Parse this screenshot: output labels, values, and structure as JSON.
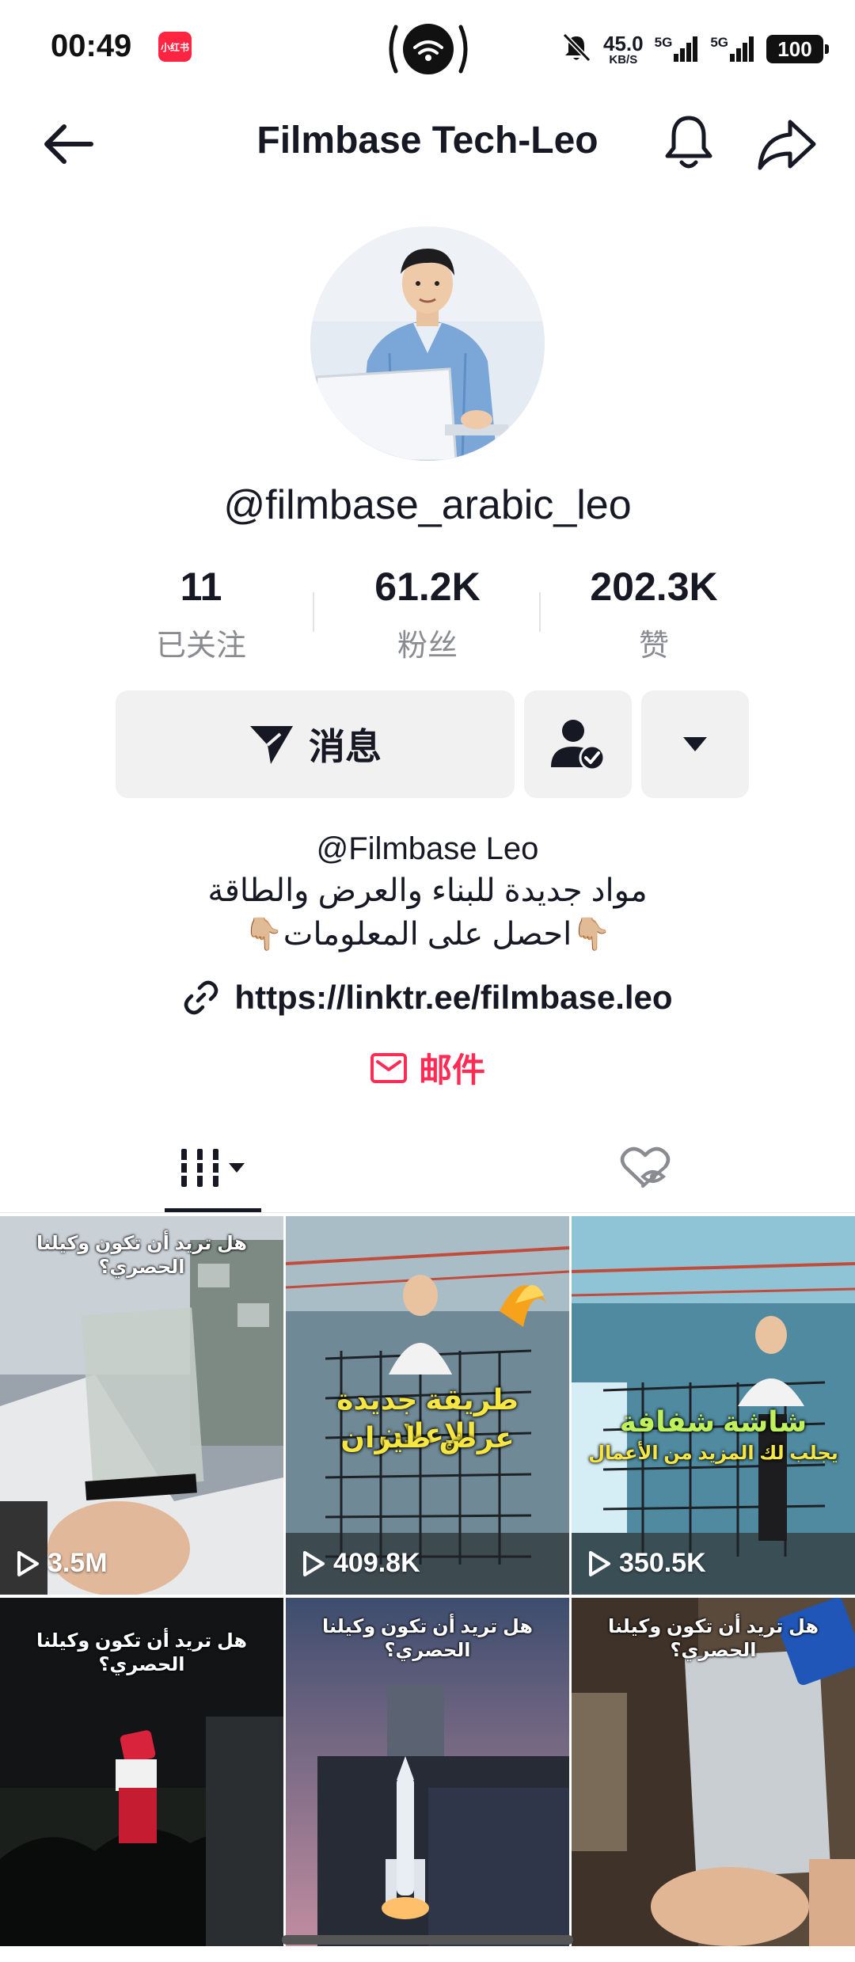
{
  "status_bar": {
    "time": "00:49",
    "app_badge": "小红书",
    "net_speed_value": "45.0",
    "net_speed_unit": "KB/S",
    "signal_1": "5G",
    "signal_2": "5G",
    "battery": "100"
  },
  "header": {
    "title": "Filmbase Tech-Leo"
  },
  "profile": {
    "handle": "@filmbase_arabic_leo",
    "stats": [
      {
        "value": "11",
        "label": "已关注"
      },
      {
        "value": "61.2K",
        "label": "粉丝"
      },
      {
        "value": "202.3K",
        "label": "赞"
      }
    ]
  },
  "actions": {
    "message_label": "消息"
  },
  "bio": {
    "line1": "@Filmbase Leo",
    "line2": "مواد جديدة للبناء والعرض والطاقة",
    "line3": "👇🏼احصل على المعلومات👇🏼",
    "link": "https://linktr.ee/filmbase.leo",
    "email_label": "邮件"
  },
  "videos": [
    {
      "views": "3.5M",
      "caption": "هل تريد أن تكون وكيلنا الحصري؟"
    },
    {
      "views": "409.8K",
      "caption_line1": "طريقة جديدة للإعلان",
      "caption_line2": "عرض طيران"
    },
    {
      "views": "350.5K",
      "caption_line1": "شاشة شفافة",
      "caption_line2": "يجلب لك المزيد من الأعمال"
    },
    {
      "caption": "هل تريد أن تكون وكيلنا الحصري؟"
    },
    {
      "caption": "هل تريد أن تكون وكيلنا الحصري؟"
    },
    {
      "caption": "هل تريد أن تكون وكيلنا الحصري؟"
    }
  ],
  "colors": {
    "accent": "#fe2c55",
    "text": "#161823",
    "muted": "#8a8b91",
    "button_bg": "#f1f1f2",
    "caption_yellow": "#f5e642"
  }
}
